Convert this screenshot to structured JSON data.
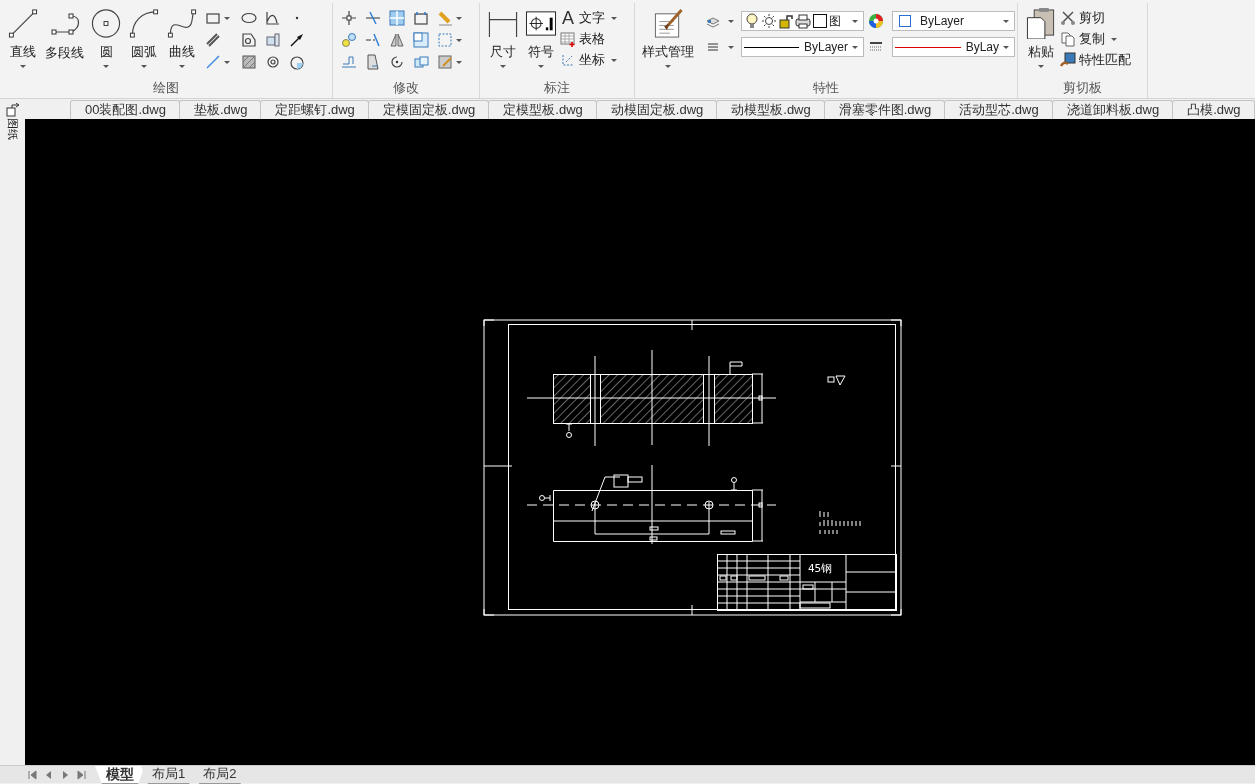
{
  "ribbon": {
    "groups": [
      {
        "title": "绘图",
        "large_buttons": [
          {
            "label": "直线",
            "dropdown": true
          },
          {
            "label": "多段线",
            "dropdown": false
          },
          {
            "label": "圆",
            "dropdown": true
          },
          {
            "label": "圆弧",
            "dropdown": true
          },
          {
            "label": "曲线",
            "dropdown": true
          }
        ],
        "icon_rows": [
          {
            "dropdown": true
          },
          {
            "dropdown": false
          },
          {
            "dropdown": true
          }
        ]
      },
      {
        "title": "修改",
        "icon_rows": [
          {
            "dropdown": true
          },
          {
            "dropdown": true
          },
          {
            "dropdown": true
          }
        ]
      },
      {
        "title": "标注",
        "large_buttons": [
          {
            "label": "尺寸",
            "dropdown": true
          },
          {
            "label": "符号",
            "dropdown": true
          }
        ],
        "small_buttons": [
          {
            "label": "文字",
            "icon_char": "A",
            "dropdown": true
          },
          {
            "label": "表格",
            "dropdown": false
          },
          {
            "label": "坐标",
            "dropdown": true
          }
        ]
      },
      {
        "title": "特性",
        "large_buttons": [
          {
            "label": "样式管理",
            "dropdown": true
          }
        ],
        "layer": {
          "value": "图"
        },
        "color": {
          "value": "ByLayer"
        },
        "linetype": {
          "value": "ByLayer"
        },
        "lineweight": {
          "value": "ByLay"
        }
      },
      {
        "title": "剪切板",
        "large_buttons": [
          {
            "label": "粘贴",
            "dropdown": true
          }
        ],
        "small_buttons": [
          {
            "label": "剪切",
            "dropdown": false
          },
          {
            "label": "复制",
            "dropdown": true
          },
          {
            "label": "特性匹配",
            "dropdown": false
          }
        ]
      }
    ]
  },
  "side_panel": {
    "label": "图纸"
  },
  "file_tabs": [
    {
      "label": "00装配图.dwg",
      "selected": false
    },
    {
      "label": "垫板.dwg",
      "selected": false
    },
    {
      "label": "定距螺钉.dwg",
      "selected": false
    },
    {
      "label": "定模固定板.dwg",
      "selected": false
    },
    {
      "label": "定模型板.dwg",
      "selected": false
    },
    {
      "label": "动模固定板.dwg",
      "selected": false
    },
    {
      "label": "动模型板.dwg",
      "selected": false
    },
    {
      "label": "滑塞零件图.dwg",
      "selected": false
    },
    {
      "label": "活动型芯.dwg",
      "selected": false
    },
    {
      "label": "浇道卸料板.dwg",
      "selected": false
    },
    {
      "label": "凸模.dwg",
      "selected": false
    }
  ],
  "drawing": {
    "material": "45钢"
  },
  "layout_tabs": [
    {
      "label": "模型",
      "selected": true
    },
    {
      "label": "布局1",
      "selected": false
    },
    {
      "label": "布局2",
      "selected": false
    }
  ]
}
